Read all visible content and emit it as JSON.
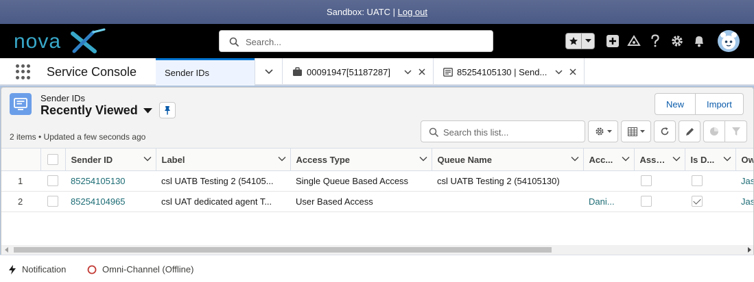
{
  "sandbox": {
    "label": "Sandbox: UATC |",
    "logout": "Log out"
  },
  "header": {
    "logo_text": "novaX",
    "search_placeholder": "Search...",
    "icons": [
      "star-icon",
      "chevron-down-icon",
      "plus-icon",
      "trailhead-icon",
      "help-icon",
      "gear-icon",
      "bell-icon",
      "avatar"
    ]
  },
  "nav": {
    "app_name": "Service Console",
    "tabs": [
      {
        "label": "Sender IDs",
        "active": true
      },
      {
        "label": "00091947[51187287]",
        "icon": "briefcase-icon"
      },
      {
        "label": "85254105130 | Send...",
        "icon": "record-icon"
      }
    ]
  },
  "list_view": {
    "object_label": "Sender IDs",
    "view_name": "Recently Viewed",
    "info": "2 items • Updated a few seconds ago",
    "buttons": {
      "new": "New",
      "import": "Import"
    },
    "search_placeholder": "Search this list...",
    "columns": [
      "Sender ID",
      "Label",
      "Access Type",
      "Queue Name",
      "Acc...",
      "Assi...",
      "Is D...",
      "Ow"
    ],
    "rows": [
      {
        "num": "1",
        "sender_id": "85254105130",
        "label": "csl UATB Testing 2 (54105...",
        "access_type": "Single Queue Based Access",
        "queue_name": "csl UATB Testing 2 (54105130)",
        "acc": "",
        "assigned": false,
        "is_default": false,
        "owner": "Jaso"
      },
      {
        "num": "2",
        "sender_id": "85254104965",
        "label": "csl UAT dedicated agent T...",
        "access_type": "User Based Access",
        "queue_name": "",
        "acc": "Dani...",
        "assigned": false,
        "is_default": true,
        "owner": "Jaso"
      }
    ]
  },
  "utility": {
    "notification": "Notification",
    "omni": "Omni-Channel (Offline)"
  },
  "colors": {
    "accent": "#0176d3",
    "link": "#1b6b74",
    "header_bg": "#000000",
    "sandbox_bg": "#4a5a85",
    "workspace_bg": "#b0c4df"
  }
}
